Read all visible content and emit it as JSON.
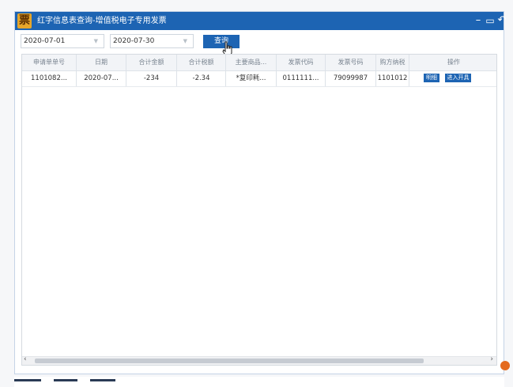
{
  "window": {
    "title": "红字信息表查询-增值税电子专用发票",
    "icon_char": "票",
    "minimize_symbol": "–",
    "maximize_symbol": "▭",
    "back_symbol": "↶"
  },
  "filters": {
    "start_date": "2020-07-01",
    "end_date": "2020-07-30",
    "query_label": "查询"
  },
  "table": {
    "columns": [
      "申请单单号",
      "日期",
      "合计金额",
      "合计税额",
      "主要商品...",
      "发票代码",
      "发票号码",
      "购方纳税",
      "操作"
    ],
    "rows": [
      {
        "cells": [
          "1101082...",
          "2020-07...",
          "-234",
          "-2.34",
          "*复印耗...",
          "0111111...",
          "79099987",
          "1101012"
        ],
        "actions": {
          "detail": "明细",
          "issue": "进入开具"
        }
      }
    ]
  },
  "colors": {
    "accent": "#1d64b3",
    "icon": "#e6a62a"
  }
}
